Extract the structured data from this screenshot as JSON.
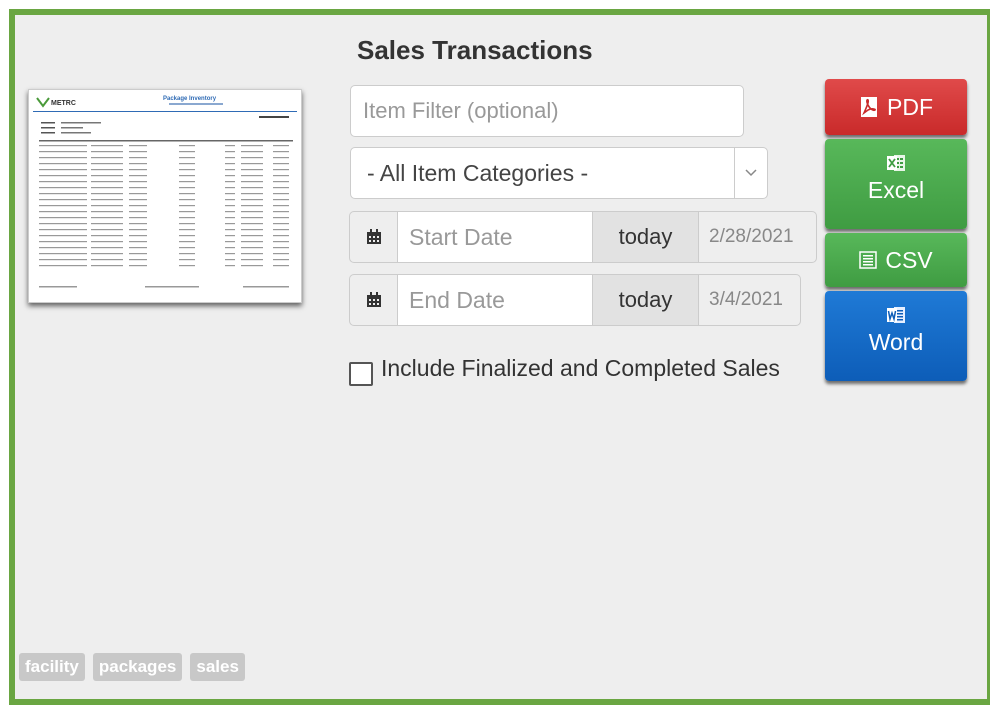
{
  "title": "Sales Transactions",
  "thumbnail": {
    "logo": "METRC",
    "heading": "Package Inventory"
  },
  "filter": {
    "placeholder": "Item Filter (optional)",
    "value": ""
  },
  "category_select": {
    "selected": "- All Item Categories -"
  },
  "start_date": {
    "placeholder": "Start Date",
    "today_label": "today",
    "value": "2/28/2021"
  },
  "end_date": {
    "placeholder": "End Date",
    "today_label": "today",
    "value": "3/4/2021"
  },
  "include_checkbox": {
    "label": "Include Finalized and Completed Sales",
    "checked": false
  },
  "buttons": {
    "pdf": "PDF",
    "excel": "Excel",
    "csv": "CSV",
    "word": "Word"
  },
  "tags": [
    "facility",
    "packages",
    "sales"
  ],
  "colors": {
    "frame": "#6aa642",
    "pdf": "#d23a3a",
    "excel": "#4aaa4d",
    "word": "#1569c7"
  },
  "icons": {
    "calendar": "calendar-icon",
    "pdf": "pdf-icon",
    "excel": "excel-icon",
    "csv": "csv-icon",
    "word": "word-icon",
    "dropdown": "chevron-down-icon"
  }
}
